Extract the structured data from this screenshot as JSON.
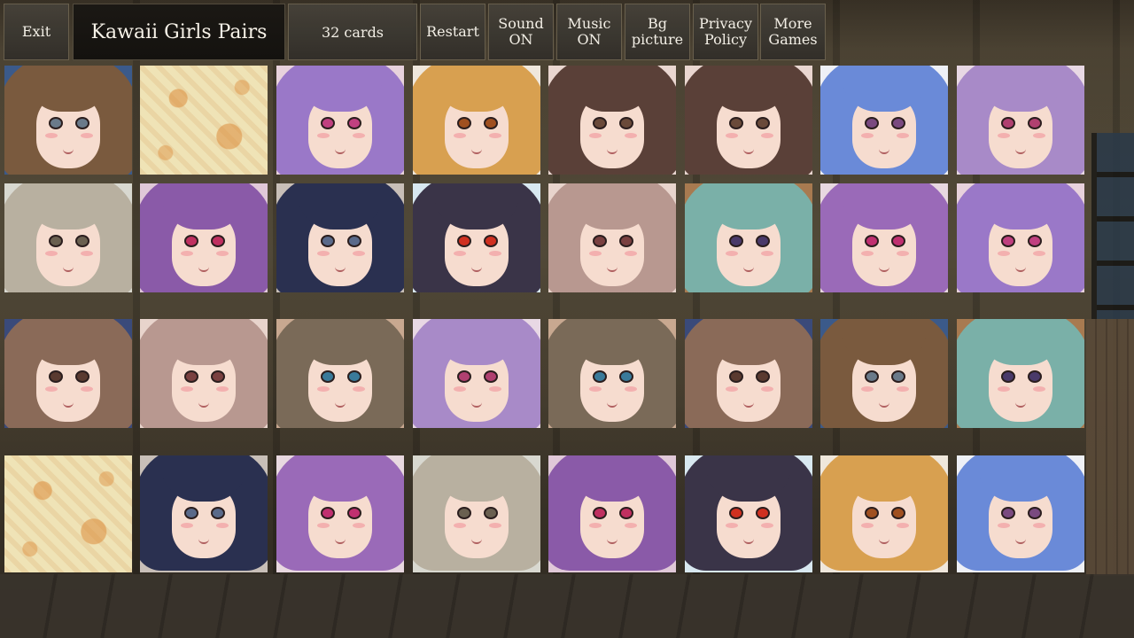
{
  "toolbar": {
    "exit_label": "Exit",
    "title": "Kawaii Girls Pairs",
    "card_count": "32 cards",
    "restart_label": "Restart",
    "sound_label": "Sound ON",
    "music_label": "Music ON",
    "bg_label": "Bg picture",
    "privacy_label": "Privacy Policy",
    "more_label": "More Games"
  },
  "board": {
    "rows": 4,
    "cols": 8,
    "cards": [
      {
        "state": "faceup",
        "character": "brown-hair-girl"
      },
      {
        "state": "facedown",
        "character": ""
      },
      {
        "state": "faceup",
        "character": "purple-hair-girl"
      },
      {
        "state": "faceup",
        "character": "blonde-girl"
      },
      {
        "state": "faceup",
        "character": "brown-long-hair-girl"
      },
      {
        "state": "faceup",
        "character": "brown-long-hair-girl"
      },
      {
        "state": "faceup",
        "character": "blue-hair-girl"
      },
      {
        "state": "faceup",
        "character": "lavender-hair-girl"
      },
      {
        "state": "faceup",
        "character": "gray-cap-girl"
      },
      {
        "state": "faceup",
        "character": "purple-twintail-girl"
      },
      {
        "state": "faceup",
        "character": "navy-hair-girl"
      },
      {
        "state": "faceup",
        "character": "black-hair-red-eyes-girl"
      },
      {
        "state": "faceup",
        "character": "pink-beige-hair-girl"
      },
      {
        "state": "faceup",
        "character": "teal-hair-girl"
      },
      {
        "state": "faceup",
        "character": "purple-bow-girl"
      },
      {
        "state": "faceup",
        "character": "purple-hair-girl"
      },
      {
        "state": "faceup",
        "character": "bob-brown-hair-girl"
      },
      {
        "state": "faceup",
        "character": "pink-beige-hair-girl"
      },
      {
        "state": "faceup",
        "character": "ash-brown-hair-girl"
      },
      {
        "state": "faceup",
        "character": "lavender-hair-girl"
      },
      {
        "state": "faceup",
        "character": "ash-brown-hair-girl"
      },
      {
        "state": "faceup",
        "character": "bob-brown-hair-girl"
      },
      {
        "state": "faceup",
        "character": "brown-hair-girl"
      },
      {
        "state": "faceup",
        "character": "teal-hair-girl"
      },
      {
        "state": "facedown",
        "character": ""
      },
      {
        "state": "faceup",
        "character": "navy-hair-girl"
      },
      {
        "state": "faceup",
        "character": "purple-bow-girl"
      },
      {
        "state": "faceup",
        "character": "gray-cap-girl"
      },
      {
        "state": "faceup",
        "character": "purple-twintail-girl"
      },
      {
        "state": "faceup",
        "character": "black-hair-red-eyes-girl"
      },
      {
        "state": "faceup",
        "character": "blonde-girl"
      },
      {
        "state": "faceup",
        "character": "blue-hair-girl"
      }
    ]
  },
  "palette": {
    "brown-hair-girl": {
      "hair": "#7a5a3e",
      "bg": "#3b5a8a",
      "eye": "#6a7a8a"
    },
    "purple-hair-girl": {
      "hair": "#9a78c8",
      "bg": "#e8d2dc",
      "eye": "#c04080"
    },
    "blonde-girl": {
      "hair": "#d8a050",
      "bg": "#efe7dc",
      "eye": "#a05020"
    },
    "brown-long-hair-girl": {
      "hair": "#5a4038",
      "bg": "#e9d6d0",
      "eye": "#6a4a3a"
    },
    "blue-hair-girl": {
      "hair": "#6a8ad8",
      "bg": "#eef0f6",
      "eye": "#7a4a80"
    },
    "lavender-hair-girl": {
      "hair": "#a88ac8",
      "bg": "#e8d8e4",
      "eye": "#b04070"
    },
    "gray-cap-girl": {
      "hair": "#b8b0a0",
      "bg": "#d8d8d0",
      "eye": "#6a6050"
    },
    "purple-twintail-girl": {
      "hair": "#8a5aa8",
      "bg": "#e0c8d8",
      "eye": "#c03060"
    },
    "navy-hair-girl": {
      "hair": "#2a3050",
      "bg": "#c8bfb8",
      "eye": "#5a6a8a"
    },
    "black-hair-red-eyes-girl": {
      "hair": "#3a3448",
      "bg": "#d8e8f0",
      "eye": "#d03020"
    },
    "pink-beige-hair-girl": {
      "hair": "#b89890",
      "bg": "#e8d4cc",
      "eye": "#7a4040"
    },
    "teal-hair-girl": {
      "hair": "#7ab0a8",
      "bg": "#a87a50",
      "eye": "#4a3a6a"
    },
    "purple-bow-girl": {
      "hair": "#9a6ab8",
      "bg": "#e8d8e0",
      "eye": "#c03070"
    },
    "bob-brown-hair-girl": {
      "hair": "#8a6a58",
      "bg": "#3a4a7a",
      "eye": "#5a3a30"
    },
    "ash-brown-hair-girl": {
      "hair": "#7a6a58",
      "bg": "#c8a890",
      "eye": "#3a7a9a"
    }
  }
}
